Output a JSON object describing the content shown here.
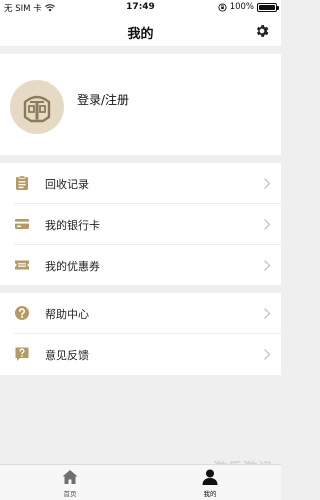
{
  "status_bar": {
    "carrier": "无 SIM 卡",
    "time": "17:49",
    "battery": "100%",
    "icons": [
      "wifi-icon",
      "orientation-lock-icon",
      "battery-icon"
    ]
  },
  "nav": {
    "title": "我的",
    "settings_icon": "gear-icon"
  },
  "profile": {
    "avatar_icon": "helmet-icon",
    "login_label": "登录/注册"
  },
  "menu_groups": [
    {
      "items": [
        {
          "label": "回收记录",
          "icon": "clipboard-icon"
        },
        {
          "label": "我的银行卡",
          "icon": "bank-card-icon"
        },
        {
          "label": "我的优惠券",
          "icon": "coupon-icon"
        }
      ]
    },
    {
      "items": [
        {
          "label": "帮助中心",
          "icon": "help-icon"
        },
        {
          "label": "意见反馈",
          "icon": "feedback-icon"
        }
      ]
    }
  ],
  "tab_bar": {
    "tabs": [
      {
        "label": "首页",
        "icon": "home-icon"
      },
      {
        "label": "我的",
        "icon": "user-icon"
      }
    ]
  },
  "watermark": "游乐游记",
  "colors": {
    "accent_gold": "#b59a63",
    "avatar_bg": "#e6dac4",
    "page_bg": "#efefef"
  }
}
